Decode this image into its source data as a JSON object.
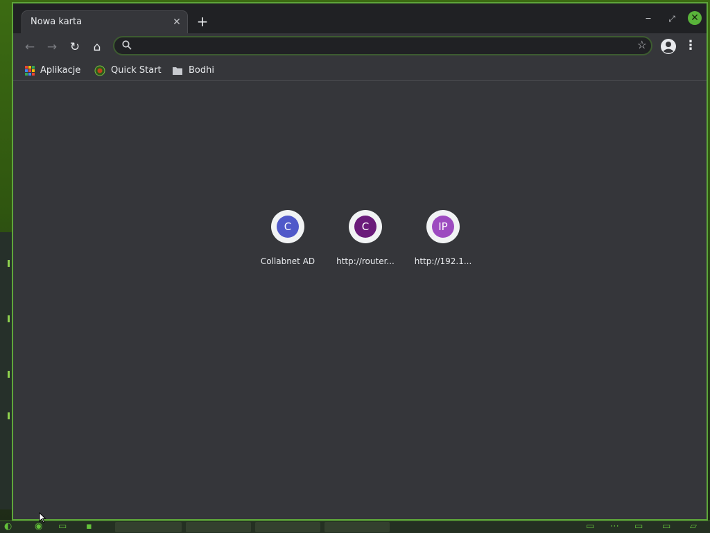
{
  "browser": {
    "tab": {
      "title": "Nowa karta",
      "close_glyph": "✕"
    },
    "new_tab_glyph": "+",
    "window_controls": {
      "minimize": "‒",
      "maximize": "⤢",
      "close": "✕"
    },
    "toolbar": {
      "back_glyph": "←",
      "forward_glyph": "→",
      "reload_glyph": "↻",
      "home_glyph": "⌂",
      "omnibox_value": "",
      "bookmark_star_glyph": "☆",
      "menu_glyph": "⋮"
    },
    "bookmarks": [
      {
        "label": "Aplikacje",
        "icon": "apps-grid-icon"
      },
      {
        "label": "Quick Start",
        "icon": "quick-start-icon"
      },
      {
        "label": "Bodhi",
        "icon": "folder-icon"
      }
    ],
    "shortcuts": [
      {
        "letter": "C",
        "label": "Collabnet AD",
        "color": "#5059c9"
      },
      {
        "letter": "C",
        "label": "http://router...",
        "color": "#6a1b7a"
      },
      {
        "letter": "IP",
        "label": "http://192.1...",
        "color": "#9d4bc0"
      }
    ]
  },
  "colors": {
    "window_border": "#5ea63a",
    "close_button": "#59b33a",
    "titlebar": "#202124",
    "page_bg": "#35363a"
  }
}
